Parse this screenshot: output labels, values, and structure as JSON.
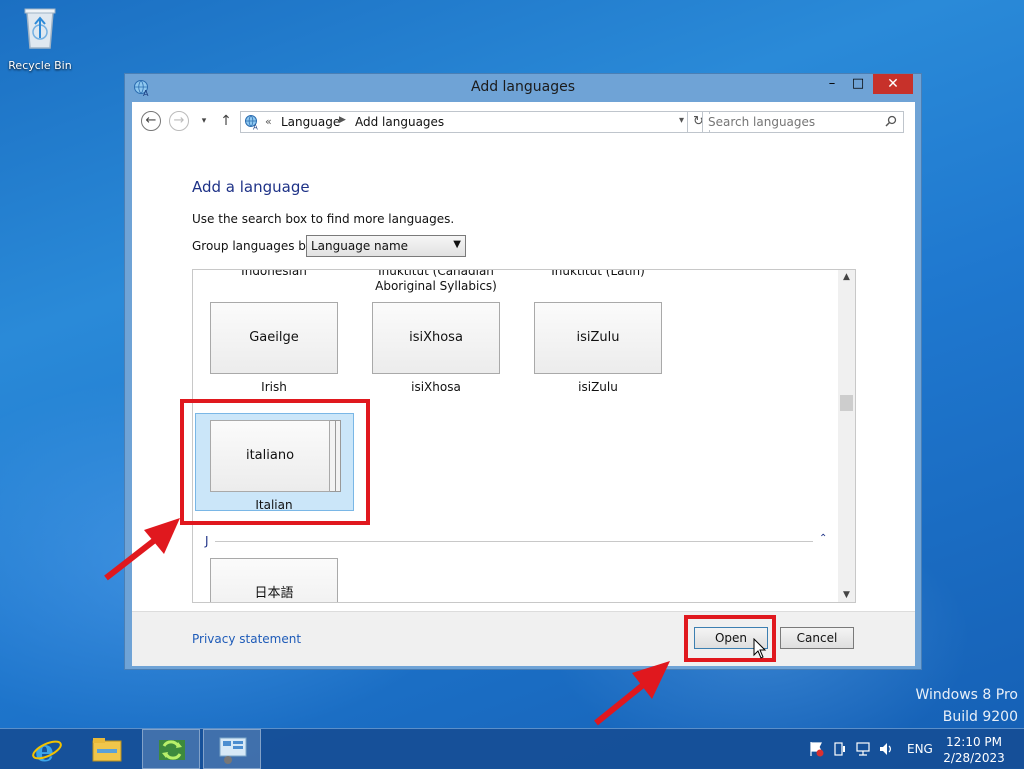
{
  "desktop": {
    "recycle_bin_label": "Recycle Bin",
    "watermark_line1": "Windows 8 Pro",
    "watermark_line2": "Build 9200"
  },
  "window": {
    "title": "Add languages",
    "minimize_symbol": "–",
    "maximize_symbol": "□",
    "close_symbol": "✕",
    "close_color": "#c7312a"
  },
  "navbar": {
    "back_symbol": "←",
    "forward_symbol": "→",
    "dropdown_symbol": "▾",
    "up_symbol": "↑",
    "address_chevron": "«",
    "breadcrumb": [
      "Language",
      "Add languages"
    ],
    "breadcrumb_separator": "▶",
    "address_dropdown_symbol": "▾",
    "refresh_symbol": "↻",
    "search_placeholder": "Search languages",
    "search_icon": "search-icon"
  },
  "content": {
    "heading": "Add a language",
    "help_text": "Use the search box to find more languages.",
    "group_label": "Group languages by:",
    "group_value": "Language name",
    "partial_labels": [
      "Indonesian",
      "Inuktitut (Canadian\nAboriginal Syllabics)",
      "Inuktitut (Latin)"
    ],
    "tiles": [
      {
        "native": "Gaeilge",
        "english": "Irish"
      },
      {
        "native": "isiXhosa",
        "english": "isiXhosa"
      },
      {
        "native": "isiZulu",
        "english": "isiZulu"
      }
    ],
    "selected_tile": {
      "native": "italiano",
      "english": "Italian"
    },
    "group_header": "J",
    "group_collapse_symbol": "⌃",
    "next_tile": {
      "native": "日本語"
    },
    "selection_color": "#cbe6f9"
  },
  "footer": {
    "privacy_link": "Privacy statement",
    "open_button": "Open",
    "cancel_button": "Cancel"
  },
  "annotations": {
    "highlight_color": "#e0181e"
  },
  "taskbar": {
    "items": [
      "internet-explorer-icon",
      "file-explorer-icon",
      "language-control-panel-icon",
      "remote-desktop-icon"
    ],
    "tray_language": "ENG",
    "time": "12:10 PM",
    "date": "2/28/2023"
  }
}
